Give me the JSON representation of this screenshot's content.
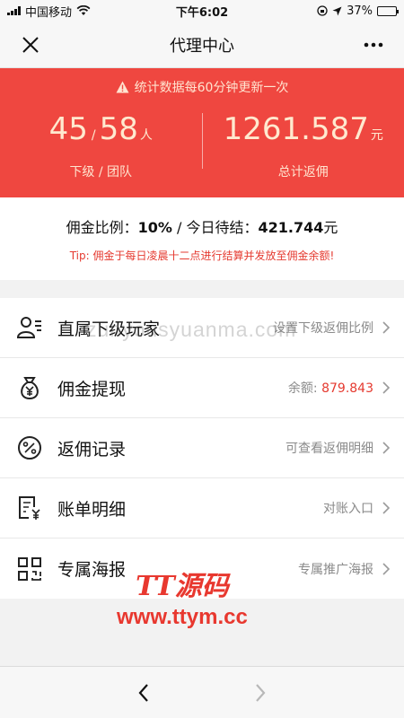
{
  "status_bar": {
    "carrier": "中国移动",
    "time": "下午6:02",
    "battery": "37%",
    "battery_level": 0.37
  },
  "nav": {
    "title": "代理中心"
  },
  "banner": {
    "notice": "统计数据每60分钟更新一次",
    "subordinates": "45",
    "slash": "/",
    "team": "58",
    "people_unit": "人",
    "subordinates_label": "下级 / 团队",
    "total_rebate": "1261.587",
    "currency_unit": "元",
    "total_rebate_label": "总计返佣"
  },
  "commission": {
    "rate_label": "佣金比例：",
    "rate_value": "10%",
    "separator": " / ",
    "pending_label": "今日待结：",
    "pending_value": "421.744",
    "pending_unit": "元",
    "tip": "Tip: 佣金于每日凌晨十二点进行结算并发放至佣金余额!"
  },
  "menu": [
    {
      "title": "直属下级玩家",
      "note": "设置下级返佣比例",
      "icon": "users-list-icon"
    },
    {
      "title": "佣金提现",
      "note_label": "余额: ",
      "note_value": "879.843",
      "icon": "money-bag-icon"
    },
    {
      "title": "返佣记录",
      "note": "可查看返佣明细",
      "icon": "percent-icon"
    },
    {
      "title": "账单明细",
      "note": "对账入口",
      "icon": "bill-icon"
    },
    {
      "title": "专属海报",
      "note": "专属推广海报",
      "icon": "qr-code-icon"
    }
  ],
  "watermarks": {
    "text": "zunyousyuanma.com",
    "logo_line1": "TT源码",
    "logo_line2": "www.ttym.cc"
  },
  "colors": {
    "banner": "#ef4740",
    "accent_red": "#e53a30"
  }
}
